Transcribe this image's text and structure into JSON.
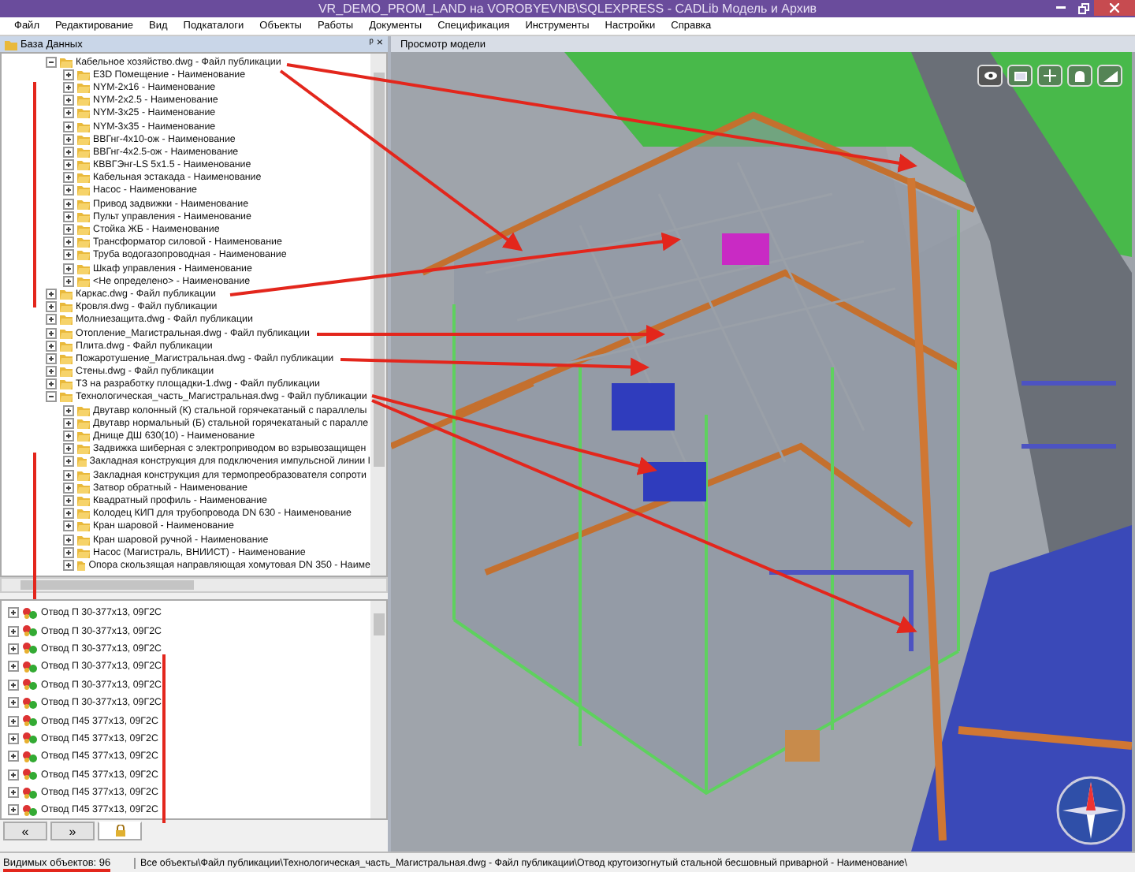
{
  "window": {
    "title": "VR_DEMO_PROM_LAND на VOROBYEVNB\\SQLEXPRESS - CADLib Модель и Архив"
  },
  "menu": [
    "Файл",
    "Редактирование",
    "Вид",
    "Подкаталоги",
    "Объекты",
    "Работы",
    "Документы",
    "Спецификация",
    "Инструменты",
    "Настройки",
    "Справка"
  ],
  "db_panel": {
    "title": "База Данных",
    "pin": "ᵖ",
    "close": "×",
    "tree": [
      {
        "label": "Кабельное хозяйство.dwg - Файл публикации",
        "expanded": true,
        "children": [
          {
            "label": "E3D Помещение - Наименование",
            "expanded": false
          },
          {
            "label": "NYM-2x16 - Наименование",
            "expanded": false
          },
          {
            "label": "NYM-2x2.5 - Наименование",
            "expanded": false
          },
          {
            "label": "NYM-3x25 - Наименование",
            "expanded": false
          },
          {
            "label": "NYM-3x35 - Наименование",
            "expanded": false
          },
          {
            "label": "ВВГнг-4x10-ож - Наименование",
            "expanded": false
          },
          {
            "label": "ВВГнг-4x2.5-ож - Наименование",
            "expanded": false
          },
          {
            "label": "КВВГЭнг-LS 5x1.5 - Наименование",
            "expanded": false
          },
          {
            "label": "Кабельная эстакада - Наименование",
            "expanded": false
          },
          {
            "label": "Насос - Наименование",
            "expanded": false
          },
          {
            "label": "Привод задвижки - Наименование",
            "expanded": false
          },
          {
            "label": "Пульт управления - Наименование",
            "expanded": false
          },
          {
            "label": "Стойка ЖБ - Наименование",
            "expanded": false
          },
          {
            "label": "Трансформатор силовой - Наименование",
            "expanded": false
          },
          {
            "label": "Труба водогазопроводная - Наименование",
            "expanded": false
          },
          {
            "label": "Шкаф управления - Наименование",
            "expanded": false
          },
          {
            "label": "<Не определено> - Наименование",
            "expanded": false
          }
        ]
      },
      {
        "label": "Каркас.dwg - Файл публикации",
        "expanded": false
      },
      {
        "label": "Кровля.dwg - Файл публикации",
        "expanded": false
      },
      {
        "label": "Молниезащита.dwg - Файл публикации",
        "expanded": false
      },
      {
        "label": "Отопление_Магистральная.dwg - Файл публикации",
        "expanded": false
      },
      {
        "label": "Плита.dwg - Файл публикации",
        "expanded": false
      },
      {
        "label": "Пожаротушение_Магистральная.dwg - Файл публикации",
        "expanded": false
      },
      {
        "label": "Стены.dwg - Файл публикации",
        "expanded": false
      },
      {
        "label": "ТЗ на разработку площадки-1.dwg - Файл публикации",
        "expanded": false
      },
      {
        "label": "Технологическая_часть_Магистральная.dwg - Файл публикации",
        "expanded": true,
        "children": [
          {
            "label": "Двутавр колонный (К) стальной горячекатаный с параллелы",
            "expanded": false
          },
          {
            "label": "Двутавр нормальный (Б) стальной горячекатаный с паралле",
            "expanded": false
          },
          {
            "label": "Днище ДШ 630(10) - Наименование",
            "expanded": false
          },
          {
            "label": "Задвижка шиберная с электроприводом во взрывозащищен",
            "expanded": false
          },
          {
            "label": "Закладная конструкция для подключения импульсной линии I",
            "expanded": false
          },
          {
            "label": "Закладная конструкция для термопреобразователя  сопроти",
            "expanded": false
          },
          {
            "label": "Затвор обратный - Наименование",
            "expanded": false
          },
          {
            "label": "Квадратный профиль - Наименование",
            "expanded": false
          },
          {
            "label": "Колодец  КИП для трубопровода DN 630 - Наименование",
            "expanded": false
          },
          {
            "label": "Кран шаровой - Наименование",
            "expanded": false
          },
          {
            "label": "Кран шаровой ручной - Наименование",
            "expanded": false
          },
          {
            "label": "Насос (Магистраль, ВНИИСТ) - Наименование",
            "expanded": false
          },
          {
            "label": "Опора скользящая направляющая хомутовая DN 350 - Наиме",
            "expanded": false
          }
        ]
      }
    ]
  },
  "objects_list": [
    "Отвод П 30-377x13, 09Г2С",
    "Отвод П 30-377x13, 09Г2С",
    "Отвод П 30-377x13, 09Г2С",
    "Отвод П 30-377x13, 09Г2С",
    "Отвод П 30-377x13, 09Г2С",
    "Отвод П 30-377x13, 09Г2С",
    "Отвод П45 377x13, 09Г2С",
    "Отвод П45 377x13, 09Г2С",
    "Отвод П45 377x13, 09Г2С",
    "Отвод П45 377x13, 09Г2С",
    "Отвод П45 377x13, 09Г2С",
    "Отвод П45 377x13, 09Г2С"
  ],
  "panel_tabs": [
    {
      "kind": "text",
      "label": "«",
      "selected": false
    },
    {
      "kind": "text",
      "label": "»",
      "selected": false
    },
    {
      "kind": "lock",
      "selected": true
    }
  ],
  "view": {
    "title": "Просмотр модели"
  },
  "status_bar": {
    "count": "Видимых объектов: 96",
    "path": "Все объекты\\Файл публикации\\Технологическая_часть_Магистральная.dwg - Файл публикации\\Отвод крутоизогнутый стальной бесшовный приварной - Наименование\\"
  }
}
